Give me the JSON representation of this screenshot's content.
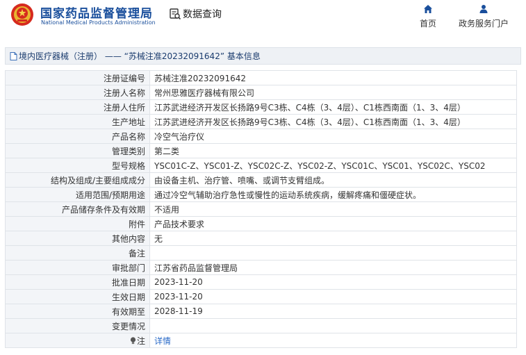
{
  "header": {
    "brand_cn": "国家药品监督管理局",
    "brand_en": "National Medical Products Administration",
    "data_query": "数据查询",
    "nav": {
      "home": "首页",
      "portal": "政务服务门户"
    }
  },
  "title_bar": {
    "text": "境内医疗器械（注册） —— “苏械注准20232091642” 基本信息"
  },
  "rows": [
    {
      "label": "注册证编号",
      "value": "苏械注准20232091642"
    },
    {
      "label": "注册人名称",
      "value": "常州思雅医疗器械有限公司"
    },
    {
      "label": "注册人住所",
      "value": "江苏武进经济开发区长扬路9号C3栋、C4栋（3、4层）、C1栋西南面（1、3、4层）"
    },
    {
      "label": "生产地址",
      "value": "江苏武进经济开发区长扬路9号C3栋、C4栋（3、4层）、C1栋西南面（1、3、4层）"
    },
    {
      "label": "产品名称",
      "value": "冷空气治疗仪"
    },
    {
      "label": "管理类别",
      "value": "第二类"
    },
    {
      "label": "型号规格",
      "value": "YSC01C-Z、YSC01-Z、YSC02C-Z、YSC02-Z、YSC01C、YSC01、YSC02C、YSC02"
    },
    {
      "label": "结构及组成/主要组成成分",
      "value": "由设备主机、治疗管、喷嘴、或调节支臂组成。"
    },
    {
      "label": "适用范围/预期用途",
      "value": "通过冷空气辅助治疗急性或慢性的运动系统疾病，缓解疼痛和僵硬症状。"
    },
    {
      "label": "产品储存条件及有效期",
      "value": "不适用"
    },
    {
      "label": "附件",
      "value": "产品技术要求"
    },
    {
      "label": "其他内容",
      "value": "无"
    },
    {
      "label": "备注",
      "value": ""
    },
    {
      "label": "审批部门",
      "value": "江苏省药品监督管理局"
    },
    {
      "label": "批准日期",
      "value": "2023-11-20"
    },
    {
      "label": "生效日期",
      "value": "2023-11-20"
    },
    {
      "label": "有效期至",
      "value": "2028-11-19"
    },
    {
      "label": "变更情况",
      "value": ""
    }
  ],
  "note_row": {
    "label": "注",
    "icon": "lightbulb-icon",
    "link": "详情"
  },
  "colors": {
    "brand": "#1a4f9c",
    "link": "#2a6ac8",
    "label_bg": "#f3f5f8",
    "title_bg": "#eef1f5"
  }
}
